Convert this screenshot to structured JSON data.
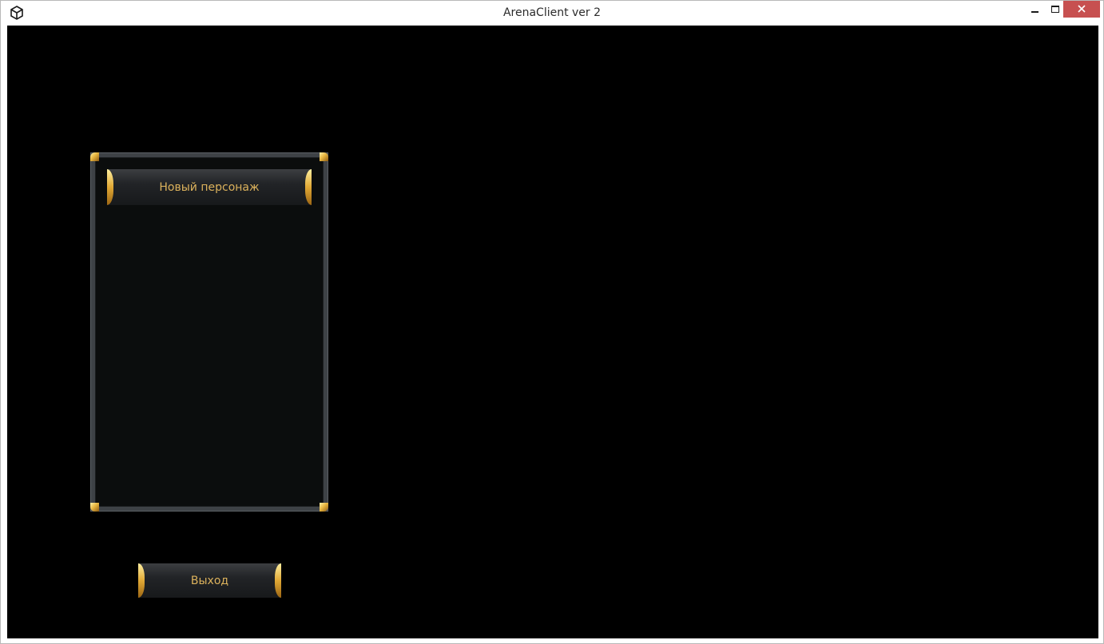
{
  "window": {
    "title": "ArenaClient ver 2",
    "app_icon": "unity-icon",
    "controls": {
      "minimize_icon": "minimize-icon",
      "maximize_icon": "maximize-icon",
      "close_icon": "close-icon",
      "close_color": "#c75050"
    }
  },
  "character_panel": {
    "new_character_label": "Новый персонаж"
  },
  "exit_label": "Выход",
  "colors": {
    "background": "#000000",
    "button_text": "#dcb25c",
    "gold_accent": "#e8b640",
    "panel_frame": "#3e4246"
  }
}
